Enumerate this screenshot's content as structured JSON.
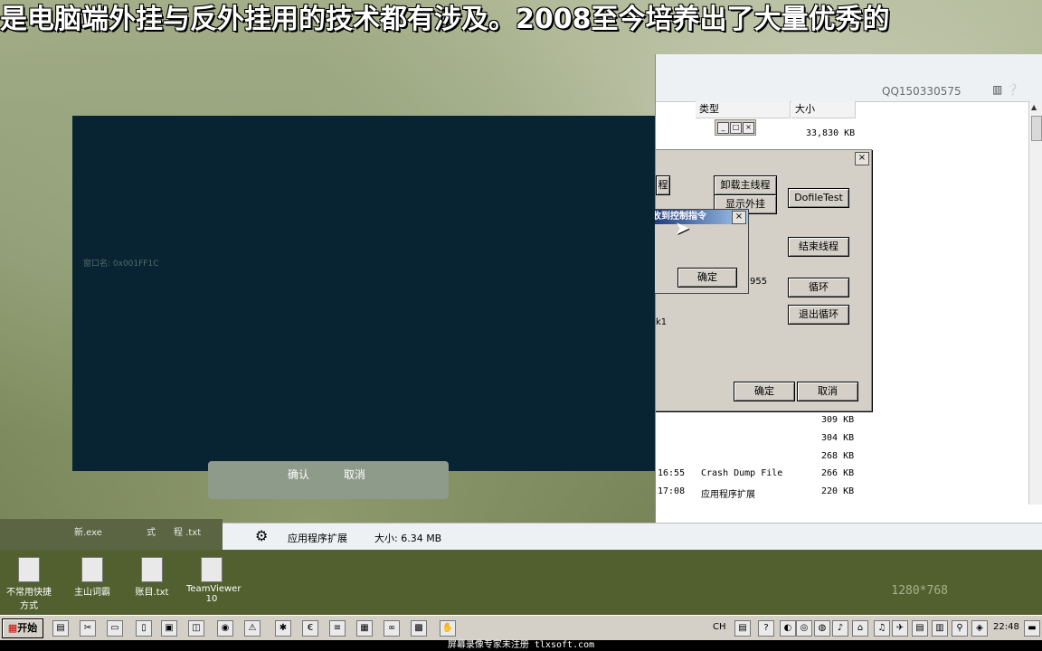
{
  "banner": "是电脑端外挂与反外挂用的技术都有涉及。2008至今培养出了大量优秀的",
  "explorer": {
    "user": "QQ150330575",
    "columns": {
      "type": "类型",
      "size": "大小"
    },
    "rows": [
      {
        "time": "",
        "type": "",
        "size": "33,830 KB"
      },
      {
        "time": "",
        "type": "",
        "size": "309 KB"
      },
      {
        "time": "",
        "type": "",
        "size": "304 KB"
      },
      {
        "time": "",
        "type": "",
        "size": "268 KB"
      },
      {
        "time": "16:55",
        "type": "Crash Dump File",
        "size": "266 KB"
      },
      {
        "time": "17:08",
        "type": "应用程序扩展",
        "size": "220 KB"
      }
    ],
    "status_type": "应用程序扩展",
    "status_size": "大小: 6.34 MB"
  },
  "dialog": {
    "buttons": {
      "thread_left": "程",
      "unload_main_thread": "卸载主线程",
      "show_plugin": "显示外挂",
      "dofile_test": "DofileTest",
      "end_thread": "结束线程",
      "loop": "循环",
      "exit_loop": "退出循环",
      "ok": "确定",
      "cancel": "取消"
    },
    "field_value": "955",
    "label_k1": "k1"
  },
  "msgbox": {
    "title": "接收到控制指令",
    "ok": "确定"
  },
  "blackpanel": {
    "text": "窗口名: 0x001FF1C"
  },
  "old_dialog": {
    "ok": "确认",
    "cancel": "取消"
  },
  "leftstrip": [
    "新.exe",
    "式",
    "程 .txt"
  ],
  "desktop_icons": [
    {
      "label": "不常用快捷方式"
    },
    {
      "label": "主山词霸"
    },
    {
      "label": "账目.txt"
    },
    {
      "label": "TeamViewer 10"
    }
  ],
  "resolution": "1280*768",
  "taskbar": {
    "start": "开始",
    "lang": "CH",
    "clock": "22:48"
  },
  "watermark": "屏幕录像专家未注册 tlxsoft.com"
}
